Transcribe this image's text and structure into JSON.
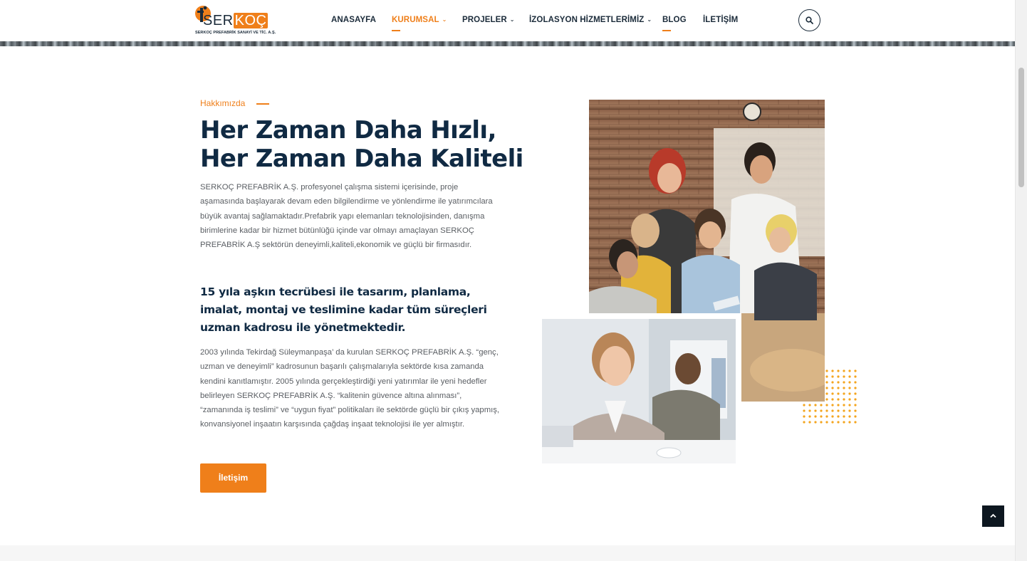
{
  "brand": {
    "name_part1": "SER",
    "name_part2": "KOÇ",
    "tagline": "SERKOÇ PREFABRİK SANAYİ VE TİC. A.Ş.",
    "accent_color": "#ef7f1a",
    "dark_color": "#102a43"
  },
  "nav": {
    "items": [
      {
        "label": "ANASAYFA",
        "dropdown": false,
        "active": false
      },
      {
        "label": "KURUMSAL",
        "dropdown": true,
        "active": true
      },
      {
        "label": "PROJELER",
        "dropdown": true,
        "active": false
      },
      {
        "label": "İZOLASYON HİZMETLERİMİZ",
        "dropdown": true,
        "active": false
      },
      {
        "label": "BLOG",
        "dropdown": false,
        "active": false
      },
      {
        "label": "İLETİŞİM",
        "dropdown": false,
        "active": false
      }
    ],
    "search_icon": "search-icon"
  },
  "about": {
    "eyebrow": "Hakkımızda",
    "title_line1": "Her Zaman Daha Hızlı,",
    "title_line2": "Her Zaman Daha Kaliteli",
    "paragraph1": "SERKOÇ PREFABRİK A.Ş. profesyonel çalışma sistemi içerisinde, proje aşamasında başlayarak devam eden bilgilendirme ve yönlendirme ile yatırımcılara büyük avantaj sağlamaktadır.Prefabrik yapı elemanları teknolojisinden, danışma birimlerine kadar bir hizmet bütünlüğü içinde var olmayı amaçlayan SERKOÇ PREFABRİK A.Ş sektörün deneyimli,kaliteli,ekonomik ve güçlü bir firmasıdır.",
    "subheading": "15 yıla aşkın tecrübesi ile tasarım, planlama, imalat, montaj ve teslimine kadar tüm süreçleri uzman kadrosu ile yönetmektedir.",
    "paragraph2": "2003 yılında Tekirdağ Süleymanpaşa’ da kurulan SERKOÇ PREFABRİK A.Ş. “genç, uzman ve deneyimli” kadrosunun başarılı çalışmalarıyla sektörde kısa zamanda kendini kanıtlamıştır. 2005 yılında gerçekleştirdiği yeni yatırımlar ile yeni hedefler belirleyen SERKOÇ PREFABRİK A.Ş. “kalitenin güvence altına alınması”, “zamanında iş teslimi” ve “uygun fiyat” politikaları ile sektörde güçlü bir çıkış yapmış, konvansiyonel inşaatın karşısında çağdaş inşaat teknolojisi ile yer almıştır.",
    "cta_label": "İletişim"
  },
  "images": {
    "team_photo": "team-meeting-photo",
    "woman_photo": "smiling-businesswoman-photo"
  },
  "back_to_top_icon": "chevron-up-icon"
}
